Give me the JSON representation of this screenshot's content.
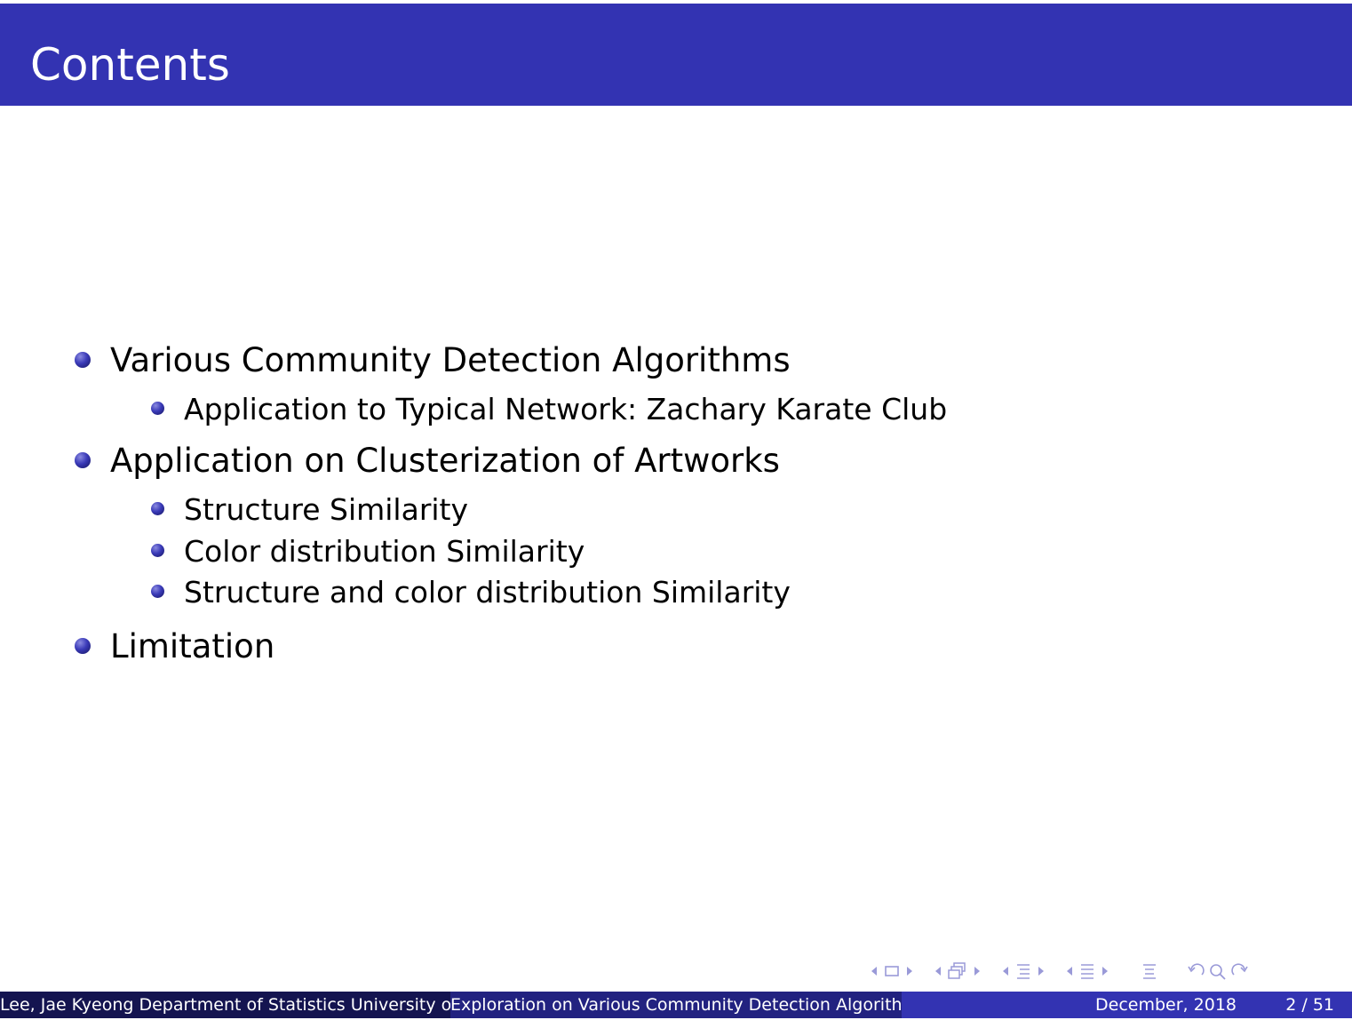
{
  "slide": {
    "title": "Contents",
    "items": [
      {
        "level": 1,
        "text": "Various Community Detection Algorithms"
      },
      {
        "level": 2,
        "text": "Application to Typical Network: Zachary Karate Club"
      },
      {
        "level": 1,
        "text": "Application on Clusterization of Artworks"
      },
      {
        "level": 2,
        "text": "Structure Similarity"
      },
      {
        "level": 2,
        "text": "Color distribution Similarity"
      },
      {
        "level": 2,
        "text": "Structure and color distribution Similarity"
      },
      {
        "level": 1,
        "text": "Limitation"
      }
    ]
  },
  "footer": {
    "author": "Lee, Jae Kyeong Department of Statistics University of Seoul",
    "short_title": "Exploration on Various Community Detection Algorithms",
    "date": "December, 2018",
    "page": "2 / 51"
  },
  "nav_icons": [
    "nav-prev-slide-icon",
    "nav-slide-icon",
    "nav-next-slide-icon",
    "nav-prev-frame-icon",
    "nav-frame-icon",
    "nav-next-frame-icon",
    "nav-prev-subsection-icon",
    "nav-subsection-icon",
    "nav-next-subsection-icon",
    "nav-prev-section-icon",
    "nav-section-icon",
    "nav-next-section-icon",
    "nav-toc-icon",
    "nav-back-icon",
    "nav-search-icon",
    "nav-forward-icon"
  ],
  "colors": {
    "title_bar": "#3333b2",
    "footer_left": "#141450",
    "footer_mid": "#222280",
    "footer_right": "#3333b2",
    "nav": "#9a9ad8"
  }
}
